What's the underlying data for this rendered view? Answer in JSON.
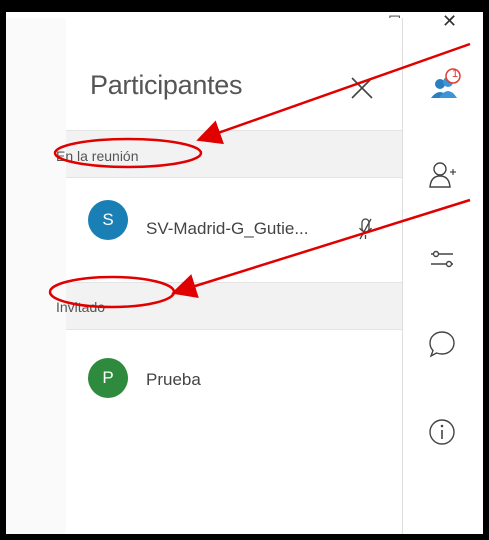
{
  "window": {
    "minimize_glyph": "–",
    "restore_glyph": "◻",
    "close_glyph": "✕"
  },
  "panel": {
    "title": "Participantes",
    "close_icon": "close-icon",
    "sections": [
      {
        "label": "En la reunión",
        "participants": [
          {
            "initial": "S",
            "name": "SV-Madrid-G_Gutie...",
            "avatar_color": "#1a7fb5",
            "mic_muted": true
          }
        ]
      },
      {
        "label": "Invitado",
        "participants": [
          {
            "initial": "P",
            "name": "Prueba",
            "avatar_color": "#2e8b3e",
            "mic_muted": false
          }
        ]
      }
    ]
  },
  "rail": {
    "participants_badge": "1",
    "icons": [
      "participants-icon",
      "add-person-icon",
      "settings-sliders-icon",
      "chat-icon",
      "info-icon"
    ]
  },
  "annotation_color": "#e00000"
}
